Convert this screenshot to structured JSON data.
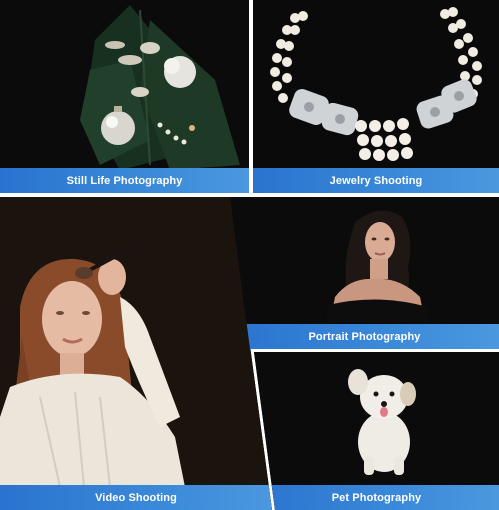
{
  "gallery": {
    "tiles": [
      {
        "caption": "Still Life Photography",
        "image": "christmas-ornament-photo"
      },
      {
        "caption": "Jewelry Shooting",
        "image": "pearl-necklace-photo"
      },
      {
        "caption": "Video Shooting",
        "image": "makeup-woman-photo"
      },
      {
        "caption": "Portrait Photography",
        "image": "portrait-woman-photo"
      },
      {
        "caption": "Pet Photography",
        "image": "white-dog-photo"
      }
    ]
  },
  "colors": {
    "caption_bar": "#3383d6",
    "caption_text": "#ffffff",
    "photo_background": "#0c0c0d",
    "separator": "#ffffff"
  }
}
